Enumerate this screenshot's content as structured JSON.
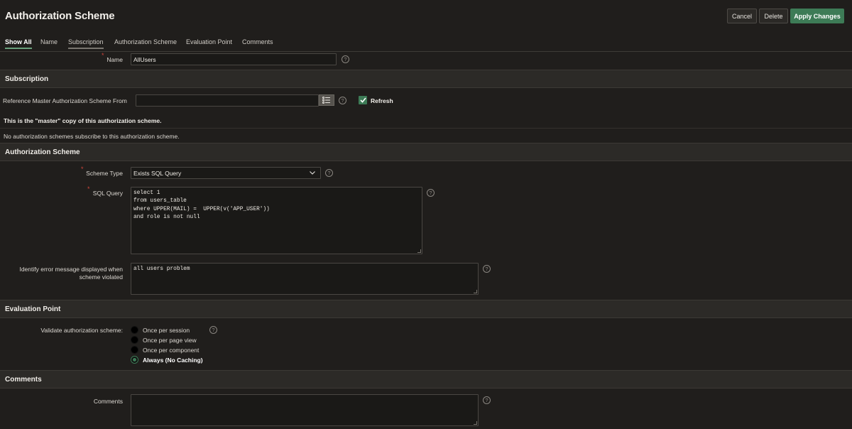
{
  "header": {
    "title": "Authorization Scheme",
    "cancel_label": "Cancel",
    "delete_label": "Delete",
    "apply_label": "Apply Changes"
  },
  "tabs": [
    {
      "label": "Show All"
    },
    {
      "label": "Name"
    },
    {
      "label": "Subscription"
    },
    {
      "label": "Authorization Scheme"
    },
    {
      "label": "Evaluation Point"
    },
    {
      "label": "Comments"
    }
  ],
  "name_field": {
    "label": "Name",
    "value": "AllUsers"
  },
  "subscription": {
    "title": "Subscription",
    "reference_label": "Reference Master Authorization Scheme From",
    "reference_value": "",
    "refresh_label": "Refresh",
    "refresh_checked": true,
    "master_note": "This is the \"master\" copy of this authorization scheme.",
    "subscribers_note": "No authorization schemes subscribe to this authorization scheme."
  },
  "authorization": {
    "title": "Authorization Scheme",
    "scheme_type_label": "Scheme Type",
    "scheme_type_value": "Exists SQL Query",
    "sql_label": "SQL Query",
    "sql_value": "select 1\nfrom users_table\nwhere UPPER(MAIL) =  UPPER(v('APP_USER'))\nand role is not null",
    "error_label_line1": "Identify error message displayed when",
    "error_label_line2": "scheme violated",
    "error_value": "all users problem"
  },
  "evaluation": {
    "title": "Evaluation Point",
    "validate_label": "Validate authorization scheme:",
    "options": [
      {
        "label": "Once per session",
        "selected": false
      },
      {
        "label": "Once per page view",
        "selected": false
      },
      {
        "label": "Once per component",
        "selected": false
      },
      {
        "label": "Always (No Caching)",
        "selected": true
      }
    ]
  },
  "comments": {
    "title": "Comments",
    "label": "Comments",
    "value": ""
  },
  "colors": {
    "background": "#201e1c",
    "accent_green": "#3d7b56",
    "required": "#d0453b"
  },
  "icons": {
    "help": "help-circle-icon",
    "list": "list-icon",
    "chevron": "chevron-down-icon",
    "check": "check-icon"
  }
}
